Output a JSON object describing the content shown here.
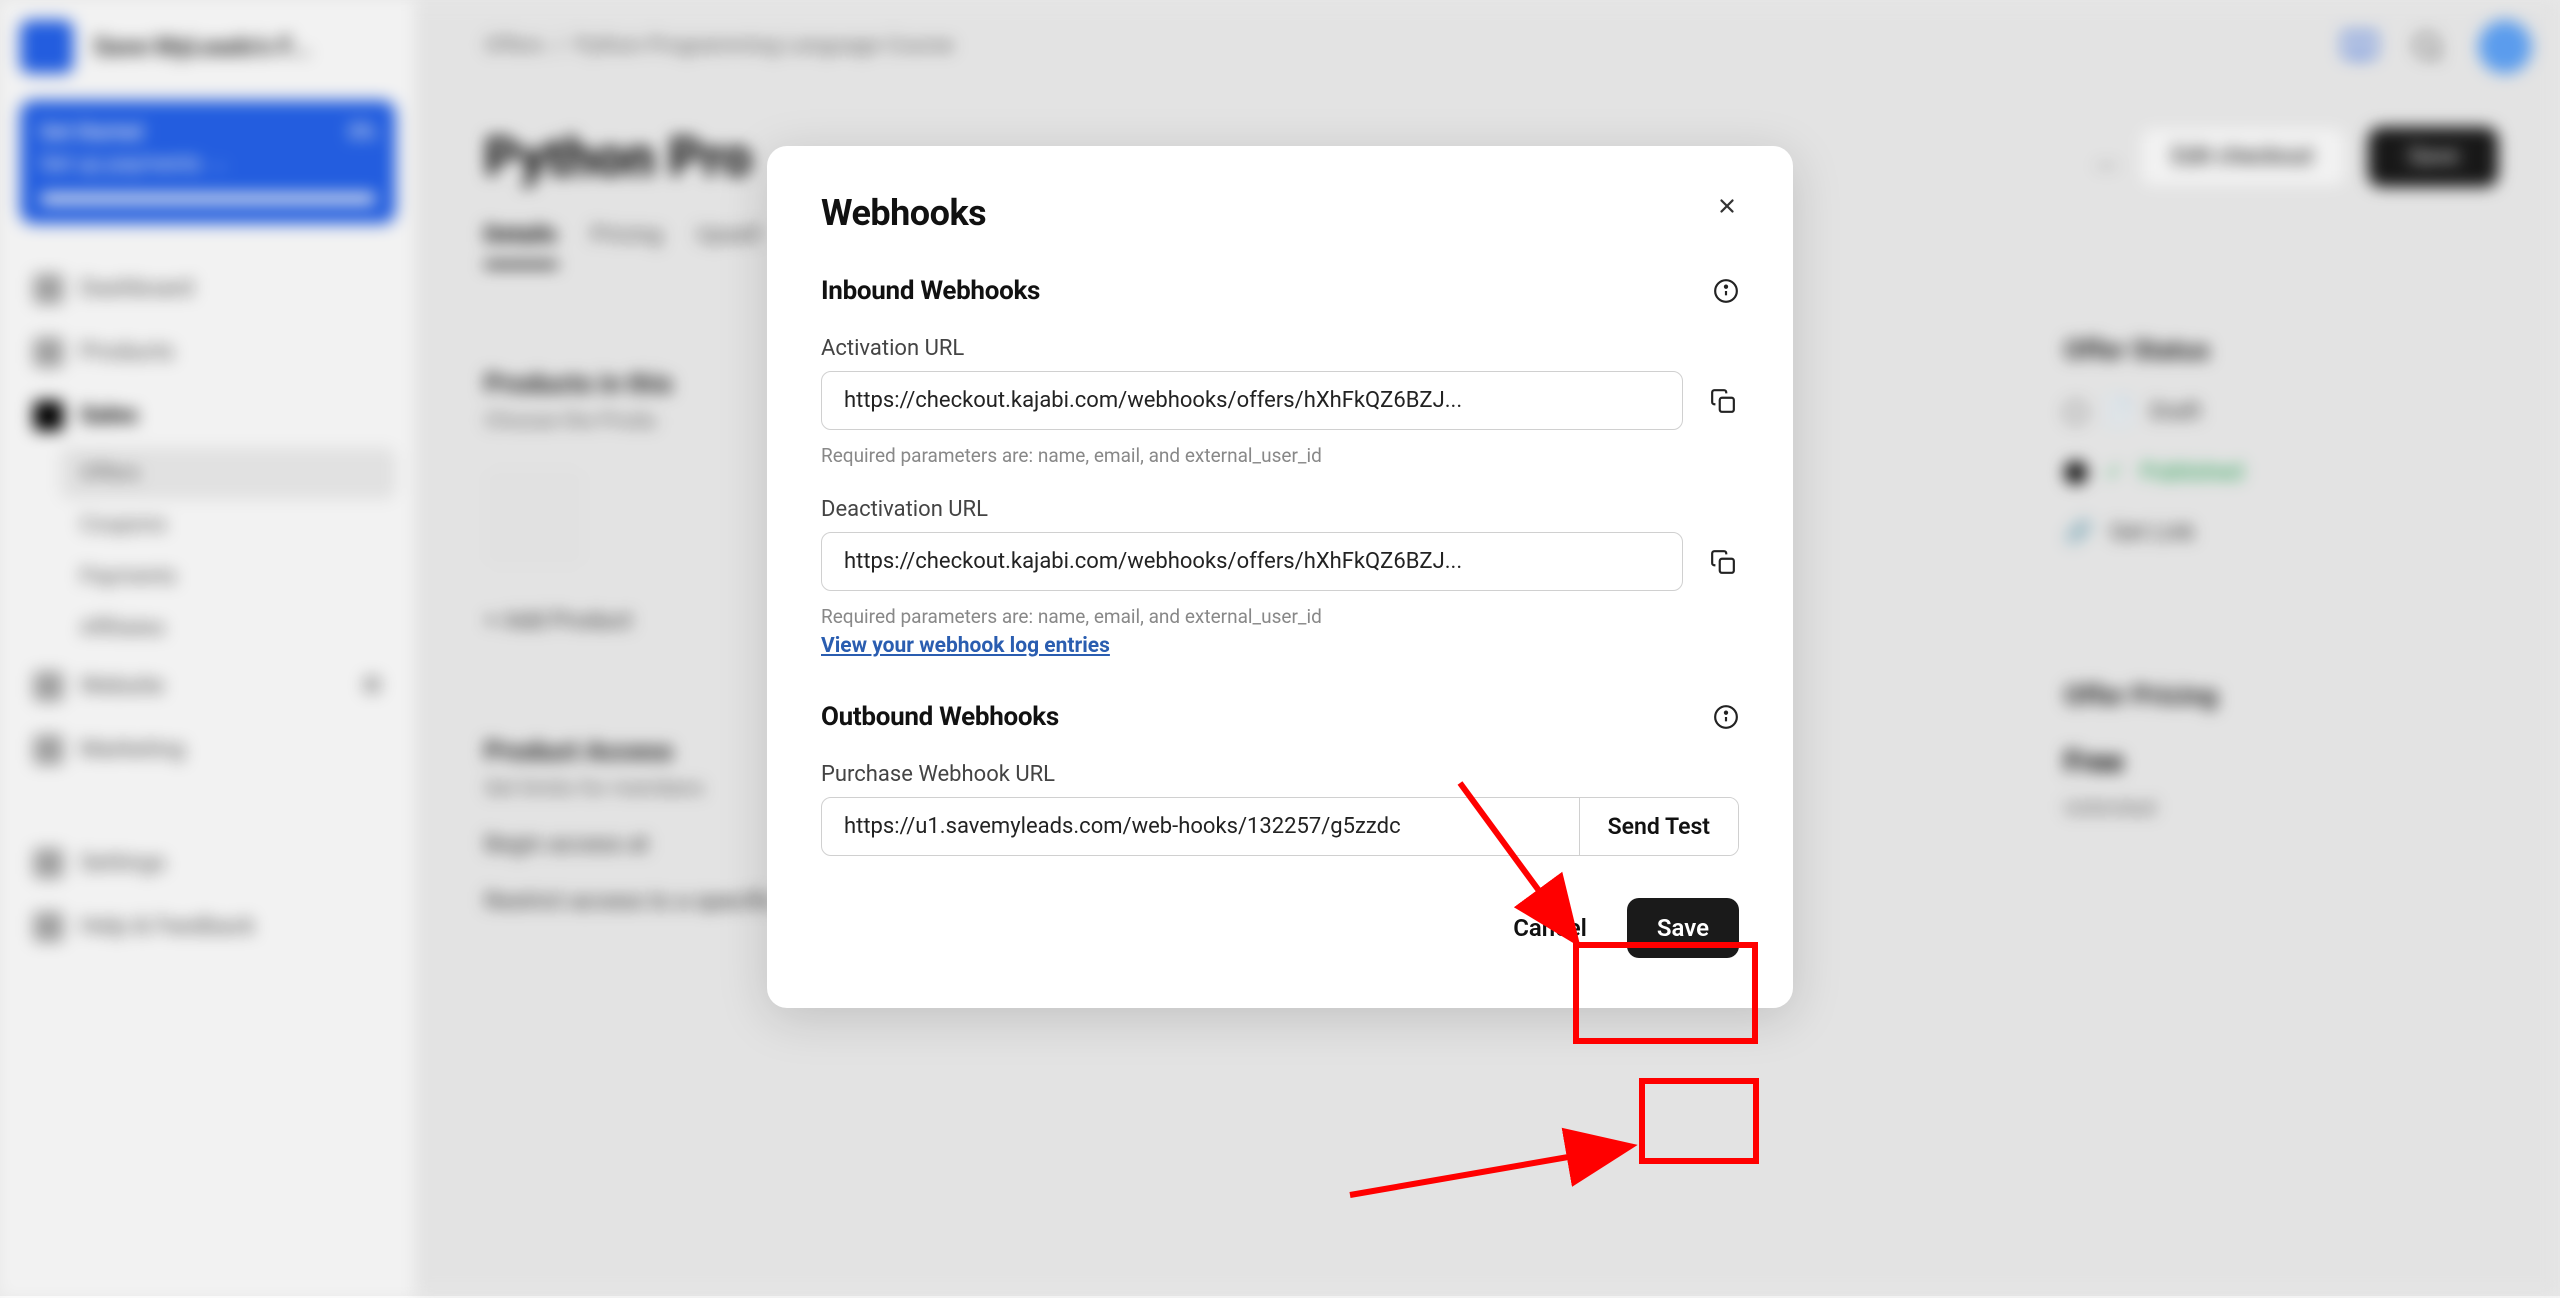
{
  "background": {
    "site_name": "Save MyLeads's F...",
    "breadcrumb_1": "Offers",
    "breadcrumb_2": "Python Programming Language Course",
    "page_title": "Python Pro",
    "more_icon": "...",
    "edit_checkout": "Edit checkout",
    "save": "Save",
    "tabs": {
      "details": "Details",
      "pricing": "Pricing",
      "upsell": "Upsell"
    },
    "get_started": {
      "title": "Get Started",
      "percent": "0%",
      "subtitle": "Set up payments →"
    },
    "nav": {
      "dashboard": "Dashboard",
      "products": "Products",
      "sales": "Sales",
      "offers": "Offers",
      "coupons": "Coupons",
      "payments": "Payments",
      "affiliates": "Affiliates",
      "website": "Website",
      "marketing": "Marketing",
      "settings": "Settings",
      "help": "Help & Feedback"
    },
    "products_section": {
      "title": "Products in this",
      "subtitle": "Choose the Produ",
      "add": "+  Add Product"
    },
    "access_section": {
      "title": "Product Access",
      "subtitle": "Set limits for members",
      "row1": "Begin access at",
      "row2": "Restrict access to a specific amount of days"
    },
    "right_panel": {
      "status_title": "Offer Status",
      "draft": "Draft",
      "published": "Published",
      "get_link": "Get Link",
      "pricing_title": "Offer Pricing",
      "free": "Free",
      "unlimited": "Unlimited"
    }
  },
  "modal": {
    "title": "Webhooks",
    "inbound_title": "Inbound Webhooks",
    "activation_label": "Activation URL",
    "activation_url": "https://checkout.kajabi.com/webhooks/offers/hXhFkQZ6BZJ...",
    "activation_help": "Required parameters are: name, email, and external_user_id",
    "deactivation_label": "Deactivation URL",
    "deactivation_url": "https://checkout.kajabi.com/webhooks/offers/hXhFkQZ6BZJ...",
    "deactivation_help": "Required parameters are: name, email, and external_user_id",
    "view_logs": "View your webhook log entries",
    "outbound_title": "Outbound Webhooks",
    "purchase_label": "Purchase Webhook URL",
    "purchase_url": "https://u1.savemyleads.com/web-hooks/132257/g5zzdc",
    "send_test": "Send Test",
    "cancel": "Cancel",
    "save": "Save"
  }
}
